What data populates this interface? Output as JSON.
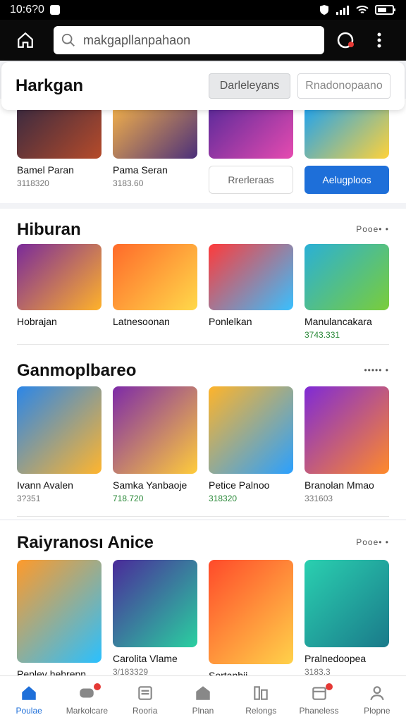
{
  "status": {
    "time": "10:6?0"
  },
  "search": {
    "placeholder": "makgapllanpahaon"
  },
  "header_card": {
    "title": "Harkgan",
    "btn1": "Darleleyans",
    "btn2": "Rnadonopaano"
  },
  "top_row": [
    {
      "name": "Bamel Paran",
      "sub": "3118320",
      "colors": [
        "#3a2a40",
        "#b64b2a"
      ]
    },
    {
      "name": "Pama Seran",
      "sub": "3183.60",
      "colors": [
        "#f2b04a",
        "#4b2f7a"
      ]
    },
    {
      "name": "",
      "sub": "",
      "colors": [
        "#5b2a9a",
        "#e64bb0"
      ],
      "tag": "Rrerleraas"
    },
    {
      "name": "",
      "sub": "",
      "colors": [
        "#1fa2ef",
        "#ffd23a"
      ],
      "tag": "Aelugploos"
    }
  ],
  "sections": [
    {
      "title": "Hiburan",
      "more": "Pooe•  •",
      "items": [
        {
          "name": "Hobrajan",
          "sub": "",
          "colors": [
            "#7a2a9a",
            "#ffb22a"
          ]
        },
        {
          "name": "Latnesoonan",
          "sub": "",
          "colors": [
            "#ff6a2a",
            "#ffd94a"
          ]
        },
        {
          "name": "Ponlelkan",
          "sub": "",
          "colors": [
            "#ff3a3a",
            "#38c0ff"
          ]
        },
        {
          "name": "Manulancakara",
          "sub": "3743.331",
          "colors": [
            "#2ab0d6",
            "#7acd3a"
          ]
        }
      ]
    },
    {
      "title": "Ganmoplbareo",
      "more": "•••••  •",
      "items": [
        {
          "name": "Ivann Avalen",
          "sub": "3?351",
          "colors": [
            "#2b86e8",
            "#ffb52e"
          ]
        },
        {
          "name": "Samka Yanbaoje",
          "sub": "718.720",
          "colors": [
            "#7d2aa8",
            "#ffcc3b"
          ]
        },
        {
          "name": "Petice Palnoo",
          "sub": "318320",
          "colors": [
            "#ffb42a",
            "#2aa0ff"
          ]
        },
        {
          "name": "Branolan Mmao",
          "sub": "331603",
          "colors": [
            "#7f2ad6",
            "#ff8a2a"
          ]
        }
      ]
    },
    {
      "title": "Raiyranosı Anice",
      "more": "Pooe•  •",
      "items": [
        {
          "name": "Peplev hehrepn",
          "sub": "",
          "colors": [
            "#ff9a2a",
            "#2ac0ff"
          ]
        },
        {
          "name": "Carolita Vlame",
          "sub": "3/183329",
          "colors": [
            "#4a2a9a",
            "#2ad0a0"
          ]
        },
        {
          "name": "Sortanhii",
          "sub": "",
          "colors": [
            "#ff4a2a",
            "#ffd24a"
          ]
        },
        {
          "name": "Pralnedoopea",
          "sub": "3183.3",
          "colors": [
            "#2ad0b0",
            "#1a7a8a"
          ]
        }
      ]
    }
  ],
  "nav": [
    {
      "label": "Poulae",
      "icon": "home-icon"
    },
    {
      "label": "Markolcare",
      "icon": "gamepad-icon"
    },
    {
      "label": "Rooria",
      "icon": "news-icon"
    },
    {
      "label": "Plnan",
      "icon": "store-icon"
    },
    {
      "label": "Relongs",
      "icon": "library-icon"
    },
    {
      "label": "Phaneless",
      "icon": "calendar-icon"
    },
    {
      "label": "Plopne",
      "icon": "profile-icon"
    }
  ],
  "colors": {
    "accent": "#1e6fd9",
    "bg": "#f2f3f6"
  }
}
